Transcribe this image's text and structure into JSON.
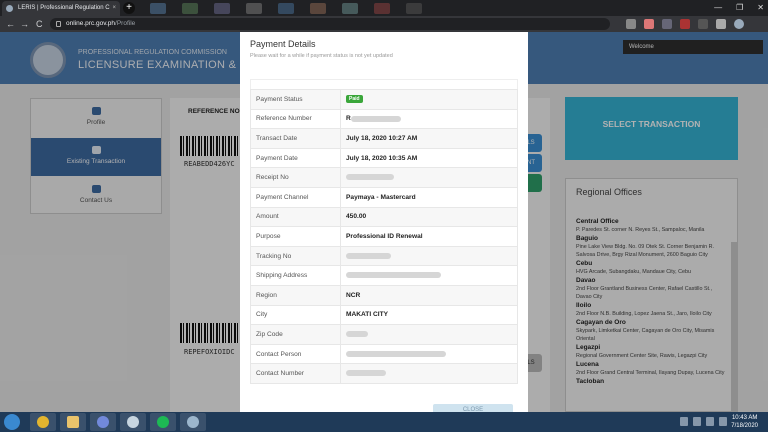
{
  "browser": {
    "tab_title": "LERIS | Professional Regulation C",
    "tab_close": "×",
    "new_tab": "+",
    "url_domain": "online.prc.gov.ph",
    "url_path": "/Profile",
    "back": "←",
    "forward": "→",
    "reload": "C",
    "window_minimize": "—",
    "window_maximize": "❐",
    "window_close": "✕"
  },
  "site": {
    "org": "PROFESSIONAL REGULATION COMMISSION",
    "title": "LICENSURE EXAMINATION & REGISTR",
    "welcome": "Welcome"
  },
  "nav": {
    "items": [
      {
        "label": "Profile"
      },
      {
        "label": "Existing Transaction"
      },
      {
        "label": "Contact Us"
      }
    ]
  },
  "content": {
    "reference_label": "REFERENCE NO.",
    "barcode_texts": [
      "REABEDD426YC",
      "REPEFOXIOIDC"
    ],
    "side_buttons": [
      "LS",
      "NT",
      "",
      "LS"
    ]
  },
  "sidebar": {
    "select_transaction": "SELECT TRANSACTION",
    "regional_title": "Regional Offices",
    "offices": [
      {
        "name": "Central Office",
        "address": "P. Paredes St. corner N. Reyes St., Sampaloc, Manila"
      },
      {
        "name": "Baguio",
        "address": "Pine Lake View Bldg. No. 09 Otek St. Corner Benjamin R. Salvosa Drive, Brgy Rizal Monument, 2600 Baguio City"
      },
      {
        "name": "Cebu",
        "address": "HVG Arcade, Subangdaku, Mandaue City, Cebu"
      },
      {
        "name": "Davao",
        "address": "2nd Floor Grantland Business Center, Rafael Castillo St., Davao City"
      },
      {
        "name": "Iloilo",
        "address": "2nd Floor N.B. Building, Lopez Jaena St., Jaro, Iloilo City"
      },
      {
        "name": "Cagayan de Oro",
        "address": "Skypark, Limketkai Center, Cagayan de Oro City, Misamis Oriental"
      },
      {
        "name": "Legazpi",
        "address": "Regional Government Center Site, Rawis, Legazpi City"
      },
      {
        "name": "Lucena",
        "address": "2nd Floor Grand Central Terminal, Ilayang Dupay, Lucena City"
      },
      {
        "name": "Tacloban",
        "address": ""
      }
    ]
  },
  "modal": {
    "title": "Payment Details",
    "note": "Please wait for a while if payment status is not yet updated",
    "close": "CLOSE",
    "rows": [
      {
        "label": "Payment Status",
        "value": "Paid",
        "badge": true
      },
      {
        "label": "Reference Number",
        "value": "R",
        "redacted": true
      },
      {
        "label": "Transact Date",
        "value": "July 18, 2020 10:27 AM"
      },
      {
        "label": "Payment Date",
        "value": "July 18, 2020 10:35 AM"
      },
      {
        "label": "Receipt No",
        "value": "",
        "redacted": true
      },
      {
        "label": "Payment Channel",
        "value": "Paymaya - Mastercard"
      },
      {
        "label": "Amount",
        "value": "450.00"
      },
      {
        "label": "Purpose",
        "value": "Professional ID Renewal"
      },
      {
        "label": "Tracking No",
        "value": "",
        "redacted": true
      },
      {
        "label": "Shipping Address",
        "value": "",
        "redacted": true
      },
      {
        "label": "Region",
        "value": "NCR"
      },
      {
        "label": "City",
        "value": "MAKATI CITY"
      },
      {
        "label": "Zip Code",
        "value": "",
        "redacted": true
      },
      {
        "label": "Contact Person",
        "value": "",
        "redacted": true
      },
      {
        "label": "Contact Number",
        "value": "",
        "redacted": true
      }
    ]
  },
  "taskbar": {
    "time": "10:43 AM",
    "date": "7/18/2020"
  },
  "colors": {
    "header_blue": "#4e7fb4",
    "nav_active": "#3d6aa1",
    "select_btn": "#35b3d5",
    "paid_badge": "#3aa63a"
  }
}
